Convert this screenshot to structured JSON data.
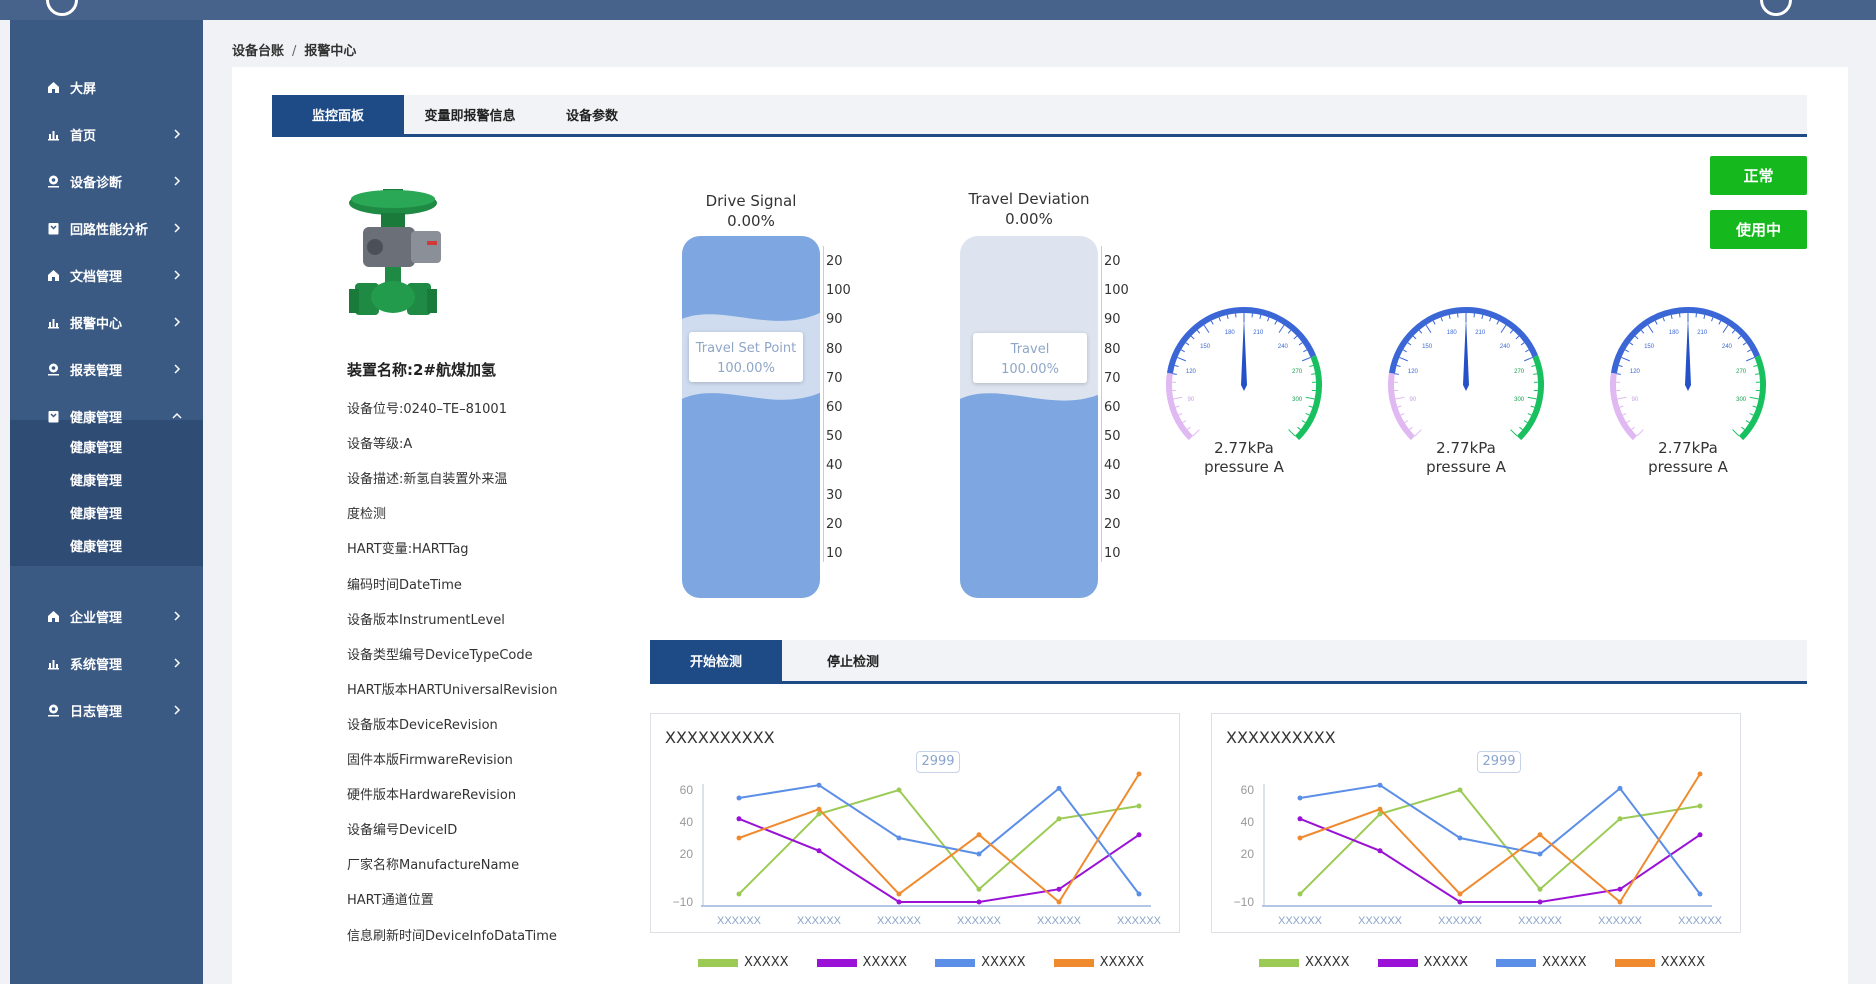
{
  "sidebar": {
    "items": [
      {
        "label": "大屏",
        "icon": "home-icon",
        "chevron": false
      },
      {
        "label": "首页",
        "icon": "bar-chart-icon",
        "chevron": true
      },
      {
        "label": "设备诊断",
        "icon": "location-icon",
        "chevron": true
      },
      {
        "label": "回路性能分析",
        "icon": "bookmark-icon",
        "chevron": true
      },
      {
        "label": "文档管理",
        "icon": "home-icon",
        "chevron": true
      },
      {
        "label": "报警中心",
        "icon": "bar-chart-icon",
        "chevron": true
      },
      {
        "label": "报表管理",
        "icon": "location-icon",
        "chevron": true
      },
      {
        "label": "健康管理",
        "icon": "bookmark-icon",
        "chevron": true,
        "expanded": true
      },
      {
        "label": "企业管理",
        "icon": "home-icon",
        "chevron": true
      },
      {
        "label": "系统管理",
        "icon": "bar-chart-icon",
        "chevron": true
      },
      {
        "label": "日志管理",
        "icon": "location-icon",
        "chevron": true
      }
    ],
    "submenu": [
      "健康管理",
      "健康管理",
      "健康管理",
      "健康管理"
    ]
  },
  "breadcrumb": {
    "root": "设备台账",
    "sep": "/",
    "current": "报警中心"
  },
  "tabs": [
    "监控面板",
    "变量即报警信息",
    "设备参数"
  ],
  "status_buttons": {
    "normal": "正常",
    "in_use": "使用中"
  },
  "device": {
    "name": "装置名称:2#航煤加氢",
    "fields": [
      "设备位号:0240–TE–81001",
      "设备等级:A",
      "设备描述:新氢自装置外来温",
      "度检测",
      "HART变量:HARTTag",
      "编码时间DateTime",
      "设备版本InstrumentLevel",
      "设备类型编号DeviceTypeCode",
      "HART版本HARTUniversalRevision",
      "设备版本DeviceRevision",
      "固件本版FirmwareRevision",
      "硬件版本HardwareRevision",
      "设备编号DeviceID",
      "厂家名称ManufactureName",
      "HART通道位置",
      "信息刷新时间DeviceInfoDataTime"
    ]
  },
  "tubes": [
    {
      "title": "Drive Signal",
      "value": "0.00%",
      "badge_label": "Travel Set Point",
      "badge_value": "100.00%",
      "fill_fraction": 0.55
    },
    {
      "title": "Travel Deviation",
      "value": "0.00%",
      "badge_label": "Travel",
      "badge_value": "100.00%",
      "fill_fraction": 0.55
    }
  ],
  "tube_ticks": [
    "20",
    "100",
    "90",
    "80",
    "70",
    "60",
    "50",
    "40",
    "30",
    "20",
    "10"
  ],
  "dials": [
    {
      "value": "2.77kPa",
      "label": "pressure A",
      "scale": [
        "90",
        "120",
        "150",
        "180",
        "210",
        "240",
        "270",
        "300"
      ]
    },
    {
      "value": "2.77kPa",
      "label": "pressure A",
      "scale": [
        "90",
        "120",
        "150",
        "180",
        "210",
        "240",
        "270",
        "300"
      ]
    },
    {
      "value": "2.77kPa",
      "label": "pressure A",
      "scale": [
        "90",
        "120",
        "150",
        "180",
        "210",
        "240",
        "270",
        "300"
      ]
    }
  ],
  "detect_tabs": [
    "开始检测",
    "停止检测"
  ],
  "colors": {
    "green": "#9ccb55",
    "purple": "#9a12d6",
    "blue": "#5b8ee6",
    "orange": "#f08a2e",
    "accent": "#1e4a86",
    "status": "#15b91d"
  },
  "chart_data": [
    {
      "type": "line",
      "title": "XXXXXXXXXX",
      "tooltip": "2999",
      "categories": [
        "XXXXXX",
        "XXXXXX",
        "XXXXXX",
        "XXXXXX",
        "XXXXXX",
        "XXXXXX"
      ],
      "yticks": [
        "60",
        "40",
        "20",
        "−10"
      ],
      "series": [
        {
          "name": "XXXXX",
          "color": "#9ccb55",
          "values": [
            -5,
            45,
            60,
            -2,
            42,
            50
          ]
        },
        {
          "name": "XXXXX",
          "color": "#9a12d6",
          "values": [
            42,
            22,
            -10,
            -10,
            -2,
            32
          ]
        },
        {
          "name": "XXXXX",
          "color": "#5b8ee6",
          "values": [
            55,
            63,
            30,
            20,
            61,
            -5
          ]
        },
        {
          "name": "XXXXX",
          "color": "#f08a2e",
          "values": [
            30,
            48,
            -5,
            32,
            -10,
            70
          ]
        }
      ]
    },
    {
      "type": "line",
      "title": "XXXXXXXXXX",
      "tooltip": "2999",
      "categories": [
        "XXXXXX",
        "XXXXXX",
        "XXXXXX",
        "XXXXXX",
        "XXXXXX",
        "XXXXXX"
      ],
      "yticks": [
        "60",
        "40",
        "20",
        "−10"
      ],
      "series": [
        {
          "name": "XXXXX",
          "color": "#9ccb55",
          "values": [
            -5,
            45,
            60,
            -2,
            42,
            50
          ]
        },
        {
          "name": "XXXXX",
          "color": "#9a12d6",
          "values": [
            42,
            22,
            -10,
            -10,
            -2,
            32
          ]
        },
        {
          "name": "XXXXX",
          "color": "#5b8ee6",
          "values": [
            55,
            63,
            30,
            20,
            61,
            -5
          ]
        },
        {
          "name": "XXXXX",
          "color": "#f08a2e",
          "values": [
            30,
            48,
            -5,
            32,
            -10,
            70
          ]
        }
      ]
    }
  ]
}
